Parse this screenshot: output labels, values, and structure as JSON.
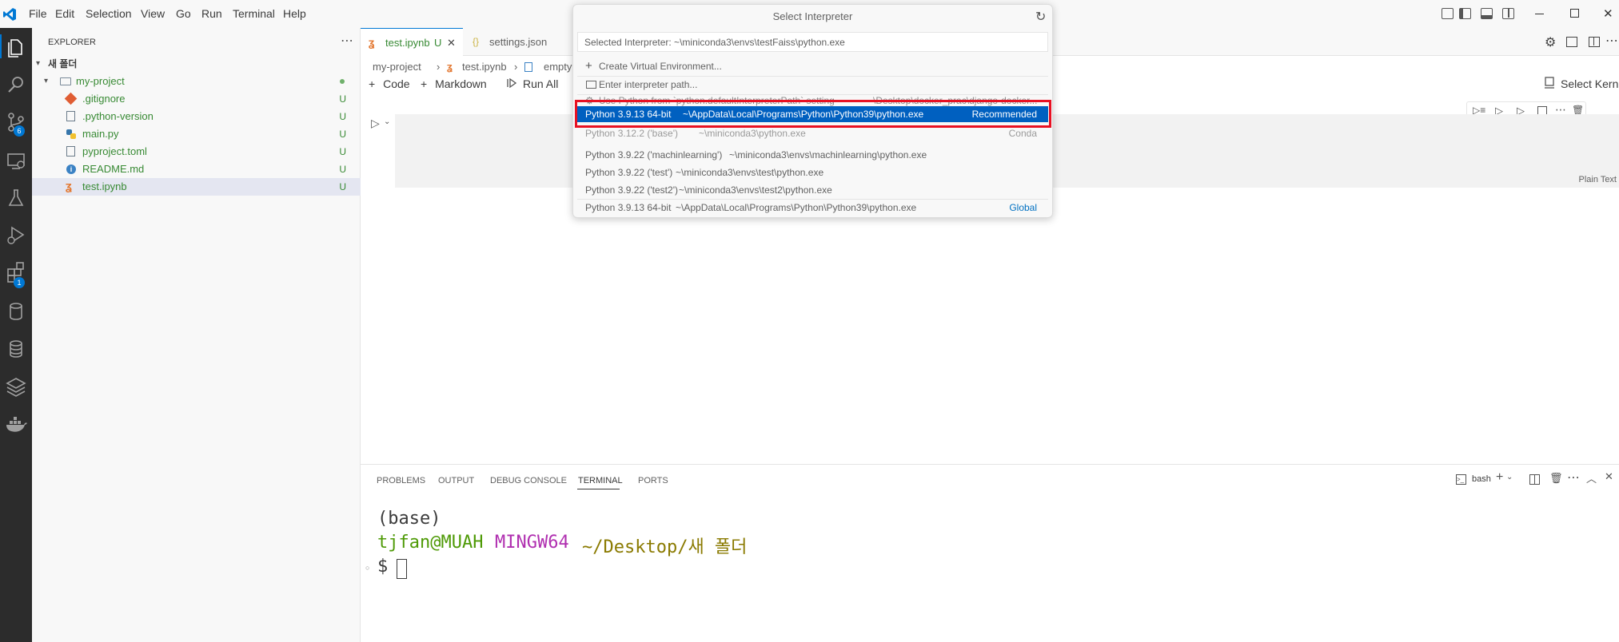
{
  "menubar": {
    "items": [
      "File",
      "Edit",
      "Selection",
      "View",
      "Go",
      "Run",
      "Terminal",
      "Help"
    ]
  },
  "activity_bar": {
    "icons": [
      "explorer-icon",
      "search-icon",
      "source-control-icon",
      "remote-explorer-icon",
      "testing-icon",
      "run-debug-icon",
      "extensions-icon",
      "database-icon",
      "database-icon",
      "layers-icon",
      "docker-icon"
    ],
    "source_control_badge": "6",
    "extensions_badge": "1"
  },
  "sidebar": {
    "title": "EXPLORER",
    "workspace": "새 폴더",
    "folder": "my-project",
    "files": [
      {
        "name": ".gitignore",
        "status": "U"
      },
      {
        "name": ".python-version",
        "status": "U"
      },
      {
        "name": "main.py",
        "status": "U"
      },
      {
        "name": "pyproject.toml",
        "status": "U"
      },
      {
        "name": "README.md",
        "status": "U"
      },
      {
        "name": "test.ipynb",
        "status": "U"
      }
    ]
  },
  "editor": {
    "tabs": [
      {
        "label": "test.ipynb",
        "status": "U"
      },
      {
        "label": "settings.json"
      }
    ],
    "breadcrumb": [
      "my-project",
      "test.ipynb",
      "empty ce"
    ],
    "toolbar": {
      "code": "Code",
      "markdown": "Markdown",
      "run_all": "Run All",
      "select_kernel": "Select Kernel"
    },
    "cell_language": "Plain Text"
  },
  "quick_pick": {
    "title": "Select Interpreter",
    "input_value": "Selected Interpreter: ~\\miniconda3\\envs\\testFaiss\\python.exe",
    "items": [
      {
        "label": "Create Virtual Environment...",
        "detail": "",
        "right": ""
      },
      {
        "label": "Enter interpreter path...",
        "detail": "",
        "right": ""
      },
      {
        "label": "Use Python from `python.defaultInterpreterPath` setting",
        "detail": "~\\Desktop\\docker_prac\\django-docker...",
        "right": ""
      },
      {
        "label": "Python 3.9.13 64-bit",
        "detail": "~\\AppData\\Local\\Programs\\Python\\Python39\\python.exe",
        "right": "Recommended"
      },
      {
        "label": "Python 3.12.2 ('base')",
        "detail": "~\\miniconda3\\python.exe",
        "right": "Conda"
      },
      {
        "label": "Python 3.9.22 ('machinlearning')",
        "detail": "~\\miniconda3\\envs\\machinlearning\\python.exe",
        "right": ""
      },
      {
        "label": "Python 3.9.22 ('test')",
        "detail": "~\\miniconda3\\envs\\test\\python.exe",
        "right": ""
      },
      {
        "label": "Python 3.9.22 ('test2')",
        "detail": "~\\miniconda3\\envs\\test2\\python.exe",
        "right": ""
      },
      {
        "label": "Python 3.9.13 64-bit",
        "detail": "~\\AppData\\Local\\Programs\\Python\\Python39\\python.exe",
        "right": "Global"
      }
    ]
  },
  "panel": {
    "tabs": [
      "PROBLEMS",
      "OUTPUT",
      "DEBUG CONSOLE",
      "TERMINAL",
      "PORTS"
    ],
    "active_tab": "TERMINAL",
    "shell": "bash",
    "terminal": {
      "line1": "(base)",
      "user_host": "tjfan@MUAH",
      "env": "MINGW64",
      "path": "~/Desktop/새 폴더",
      "prompt": "$"
    }
  },
  "colors": {
    "accent": "#0078d4",
    "selection": "#0060c0",
    "highlight_box": "#e81123",
    "git_untracked": "#388a34",
    "terminal_green": "#4e9a06",
    "terminal_magenta": "#b02fb0",
    "terminal_yellow": "#8a7a00"
  }
}
